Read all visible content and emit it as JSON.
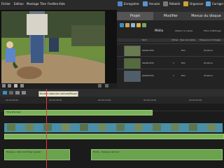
{
  "menu": [
    "Fichier",
    "Edition",
    "Montage",
    "Titre",
    "Fenêtre",
    "Aide"
  ],
  "toolbar": {
    "enregistrer": "Enregistrer",
    "annuler": "Annuler",
    "retablir": "Rétablir",
    "organiser": "Organiser",
    "corriger": "Corriger"
  },
  "tabs": [
    "Projet",
    "Modifier",
    "Menus du disque"
  ],
  "media": {
    "media_label": "Média",
    "col_headers": [
      "Nom",
      "Utilisé",
      "Type de média",
      "Fréquence d'images"
    ],
    "side_labels": [
      "Obtenir le média",
      "Filtre d'affichage"
    ],
    "rows": [
      {
        "name": "00001.MTS",
        "type": "Film",
        "rate": "25,00 i/s",
        "used": ""
      },
      {
        "name": "00002.MTS",
        "type": "Film",
        "rate": "25,00 i/s",
        "used": "✔"
      },
      {
        "name": "00003.MTS",
        "type": "Film",
        "rate": "25,00 i/s",
        "used": "✔"
      }
    ]
  },
  "tooltip": "Bouton bascule Lecture/Pause (ESPACE)",
  "timeline": {
    "ticks": [
      "00:00:00:00",
      "00:00:05:00",
      "00:00:10:00",
      "00:00:15:00",
      "00:00:20:00"
    ],
    "title_clip": "Titre Principal",
    "audio_clip_1": "Musique - Nom du fichier (Audio)",
    "audio_clip_2": "Fondu - Musique de fond"
  },
  "colors": {
    "accent": "#3a8fc7",
    "green": "#7bb35a",
    "clip": "#4a8fa8",
    "playhead": "#e03a3a"
  }
}
